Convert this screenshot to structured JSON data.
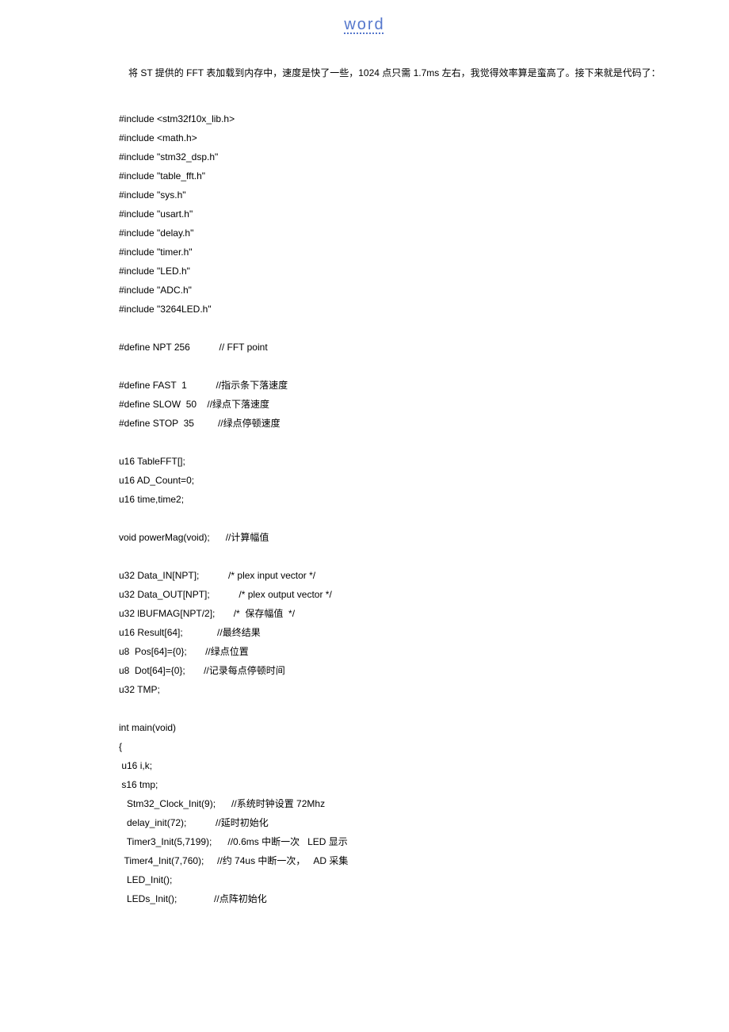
{
  "header": {
    "title": "word"
  },
  "intro": "将 ST 提供的 FFT 表加载到内存中，速度是快了一些，1024 点只需 1.7ms 左右，我觉得效率算是蛮高了。接下来就是代码了：",
  "code": {
    "lines": [
      "#include <stm32f10x_lib.h>",
      "#include <math.h>",
      "#include \"stm32_dsp.h\"",
      "#include \"table_fft.h\"",
      "#include \"sys.h\"",
      "#include \"usart.h\"",
      "#include \"delay.h\"",
      "#include \"timer.h\"",
      "#include \"LED.h\"",
      "#include \"ADC.h\"",
      "#include \"3264LED.h\"",
      "",
      "#define NPT 256           // FFT point",
      "",
      "#define FAST  1           //指示条下落速度",
      "#define SLOW  50    //绿点下落速度",
      "#define STOP  35         //绿点停顿速度",
      "",
      "u16 TableFFT[];",
      "u16 AD_Count=0;",
      "u16 time,time2;",
      "",
      "void powerMag(void);      //计算幅值",
      "",
      "u32 Data_IN[NPT];           /* plex input vector */",
      "u32 Data_OUT[NPT];           /* plex output vector */",
      "u32 lBUFMAG[NPT/2];       /*  保存幅值  */",
      "u16 Result[64];             //最终结果",
      "u8  Pos[64]={0};       //绿点位置",
      "u8  Dot[64]={0};       //记录每点停顿时间",
      "u32 TMP;",
      "",
      "int main(void)",
      "{",
      " u16 i,k;",
      " s16 tmp;",
      "   Stm32_Clock_Init(9);      //系统时钟设置 72Mhz",
      "   delay_init(72);           //延时初始化",
      "   Timer3_Init(5,7199);      //0.6ms 中断一次   LED 显示",
      "  Timer4_Init(7,760);     //约 74us 中断一次，   AD 采集",
      "   LED_Init();",
      "   LEDs_Init();              //点阵初始化"
    ]
  }
}
